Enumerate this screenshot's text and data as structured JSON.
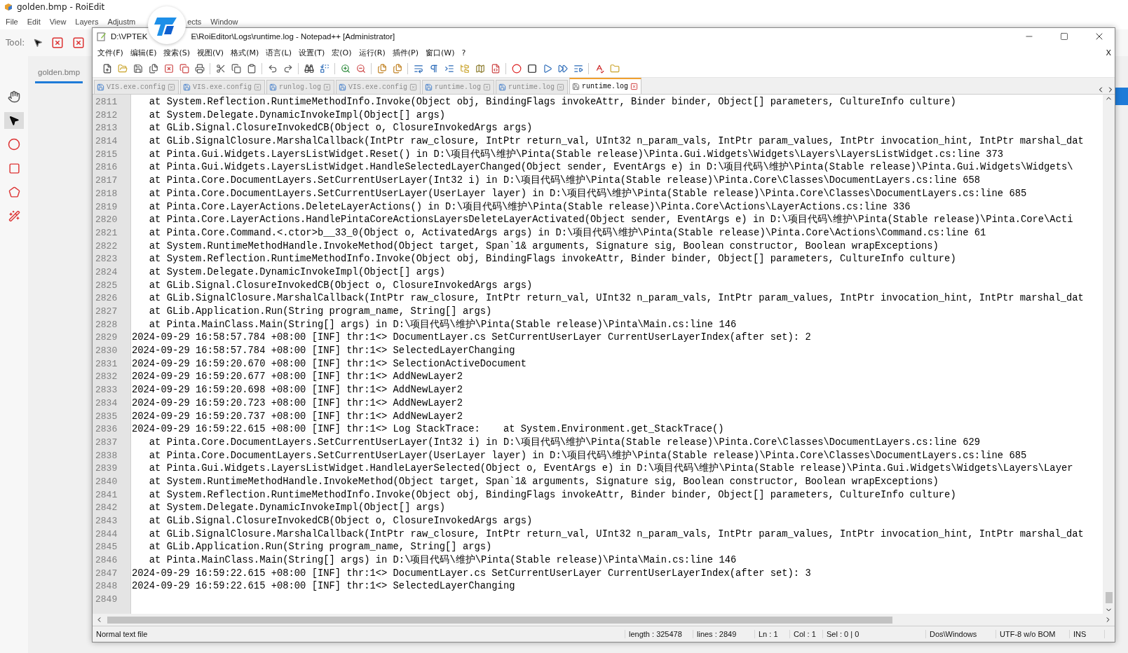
{
  "background_app": {
    "title": "golden.bmp - RoiEdit",
    "menu": [
      "File",
      "Edit",
      "View",
      "Layers",
      "Adjustm",
      "ects",
      "Window"
    ],
    "tool_label": "Tool:",
    "document_tab": "golden.bmp"
  },
  "window": {
    "title_start": "D:\\VPTEK",
    "title_end": "E\\RoiEditor\\Logs\\runtime.log - Notepad++ [Administrator]"
  },
  "menu": [
    "文件(F)",
    "编辑(E)",
    "搜索(S)",
    "视图(V)",
    "格式(M)",
    "语言(L)",
    "设置(T)",
    "宏(O)",
    "运行(R)",
    "插件(P)",
    "窗口(W)",
    "?"
  ],
  "menu_close": "X",
  "tabs": [
    {
      "label": "VIS.exe.config",
      "selected": false
    },
    {
      "label": "VIS.exe.config",
      "selected": false
    },
    {
      "label": "runlog.log",
      "selected": false
    },
    {
      "label": "VIS.exe.config",
      "selected": false
    },
    {
      "label": "runtime.log",
      "selected": false
    },
    {
      "label": "runtime.log",
      "selected": false
    },
    {
      "label": "runtime.log",
      "selected": true
    }
  ],
  "lines": [
    {
      "number": "2811",
      "kind": "trace",
      "text": "at System.Reflection.RuntimeMethodInfo.Invoke(Object obj, BindingFlags invokeAttr, Binder binder, Object[] parameters, CultureInfo culture)"
    },
    {
      "number": "2812",
      "kind": "trace",
      "text": "at System.Delegate.DynamicInvokeImpl(Object[] args)"
    },
    {
      "number": "2813",
      "kind": "trace",
      "text": "at GLib.Signal.ClosureInvokedCB(Object o, ClosureInvokedArgs args)"
    },
    {
      "number": "2814",
      "kind": "trace",
      "text": "at GLib.SignalClosure.MarshalCallback(IntPtr raw_closure, IntPtr return_val, UInt32 n_param_vals, IntPtr param_values, IntPtr invocation_hint, IntPtr marshal_dat"
    },
    {
      "number": "2815",
      "kind": "trace",
      "text": "at Pinta.Gui.Widgets.LayersListWidget.Reset() in D:\\项目代码\\维护\\Pinta(Stable release)\\Pinta.Gui.Widgets\\Widgets\\Layers\\LayersListWidget.cs:line 373"
    },
    {
      "number": "2816",
      "kind": "trace",
      "text": "at Pinta.Gui.Widgets.LayersListWidget.HandleSelectedLayerChanged(Object sender, EventArgs e) in D:\\项目代码\\维护\\Pinta(Stable release)\\Pinta.Gui.Widgets\\Widgets\\"
    },
    {
      "number": "2817",
      "kind": "trace",
      "text": "at Pinta.Core.DocumentLayers.SetCurrentUserLayer(Int32 i) in D:\\项目代码\\维护\\Pinta(Stable release)\\Pinta.Core\\Classes\\DocumentLayers.cs:line 658"
    },
    {
      "number": "2818",
      "kind": "trace",
      "text": "at Pinta.Core.DocumentLayers.SetCurrentUserLayer(UserLayer layer) in D:\\项目代码\\维护\\Pinta(Stable release)\\Pinta.Core\\Classes\\DocumentLayers.cs:line 685"
    },
    {
      "number": "2819",
      "kind": "trace",
      "text": "at Pinta.Core.LayerActions.DeleteLayerActions() in D:\\项目代码\\维护\\Pinta(Stable release)\\Pinta.Core\\Actions\\LayerActions.cs:line 336"
    },
    {
      "number": "2820",
      "kind": "trace",
      "text": "at Pinta.Core.LayerActions.HandlePintaCoreActionsLayersDeleteLayerActivated(Object sender, EventArgs e) in D:\\项目代码\\维护\\Pinta(Stable release)\\Pinta.Core\\Acti"
    },
    {
      "number": "2821",
      "kind": "trace",
      "text": "at Pinta.Core.Command.<.ctor>b__33_0(Object o, ActivatedArgs args) in D:\\项目代码\\维护\\Pinta(Stable release)\\Pinta.Core\\Actions\\Command.cs:line 61"
    },
    {
      "number": "2822",
      "kind": "trace",
      "text": "at System.RuntimeMethodHandle.InvokeMethod(Object target, Span`1& arguments, Signature sig, Boolean constructor, Boolean wrapExceptions)"
    },
    {
      "number": "2823",
      "kind": "trace",
      "text": "at System.Reflection.RuntimeMethodInfo.Invoke(Object obj, BindingFlags invokeAttr, Binder binder, Object[] parameters, CultureInfo culture)"
    },
    {
      "number": "2824",
      "kind": "trace",
      "text": "at System.Delegate.DynamicInvokeImpl(Object[] args)"
    },
    {
      "number": "2825",
      "kind": "trace",
      "text": "at GLib.Signal.ClosureInvokedCB(Object o, ClosureInvokedArgs args)"
    },
    {
      "number": "2826",
      "kind": "trace",
      "text": "at GLib.SignalClosure.MarshalCallback(IntPtr raw_closure, IntPtr return_val, UInt32 n_param_vals, IntPtr param_values, IntPtr invocation_hint, IntPtr marshal_dat"
    },
    {
      "number": "2827",
      "kind": "trace",
      "text": "at GLib.Application.Run(String program_name, String[] args)"
    },
    {
      "number": "2828",
      "kind": "trace",
      "text": "at Pinta.MainClass.Main(String[] args) in D:\\项目代码\\维护\\Pinta(Stable release)\\Pinta\\Main.cs:line 146"
    },
    {
      "number": "2829",
      "kind": "log",
      "text": "2024-09-29 16:58:57.784 +08:00 [INF] thr:1<> DocumentLayer.cs SetCurrentUserLayer CurrentUserLayerIndex(after set): 2"
    },
    {
      "number": "2830",
      "kind": "log",
      "text": "2024-09-29 16:58:57.784 +08:00 [INF] thr:1<> SelectedLayerChanging"
    },
    {
      "number": "2831",
      "kind": "log",
      "text": "2024-09-29 16:59:20.670 +08:00 [INF] thr:1<> SelectionActiveDocument"
    },
    {
      "number": "2832",
      "kind": "log",
      "text": "2024-09-29 16:59:20.677 +08:00 [INF] thr:1<> AddNewLayer2"
    },
    {
      "number": "2833",
      "kind": "log",
      "text": "2024-09-29 16:59:20.698 +08:00 [INF] thr:1<> AddNewLayer2"
    },
    {
      "number": "2834",
      "kind": "log",
      "text": "2024-09-29 16:59:20.723 +08:00 [INF] thr:1<> AddNewLayer2"
    },
    {
      "number": "2835",
      "kind": "log",
      "text": "2024-09-29 16:59:20.737 +08:00 [INF] thr:1<> AddNewLayer2"
    },
    {
      "number": "2836",
      "kind": "log",
      "text": "2024-09-29 16:59:22.615 +08:00 [INF] thr:1<> Log StackTrace:    at System.Environment.get_StackTrace()"
    },
    {
      "number": "2837",
      "kind": "trace",
      "text": "at Pinta.Core.DocumentLayers.SetCurrentUserLayer(Int32 i) in D:\\项目代码\\维护\\Pinta(Stable release)\\Pinta.Core\\Classes\\DocumentLayers.cs:line 629"
    },
    {
      "number": "2838",
      "kind": "trace",
      "text": "at Pinta.Core.DocumentLayers.SetCurrentUserLayer(UserLayer layer) in D:\\项目代码\\维护\\Pinta(Stable release)\\Pinta.Core\\Classes\\DocumentLayers.cs:line 685"
    },
    {
      "number": "2839",
      "kind": "trace",
      "text": "at Pinta.Gui.Widgets.LayersListWidget.HandleLayerSelected(Object o, EventArgs e) in D:\\项目代码\\维护\\Pinta(Stable release)\\Pinta.Gui.Widgets\\Widgets\\Layers\\Layer"
    },
    {
      "number": "2840",
      "kind": "trace",
      "text": "at System.RuntimeMethodHandle.InvokeMethod(Object target, Span`1& arguments, Signature sig, Boolean constructor, Boolean wrapExceptions)"
    },
    {
      "number": "2841",
      "kind": "trace",
      "text": "at System.Reflection.RuntimeMethodInfo.Invoke(Object obj, BindingFlags invokeAttr, Binder binder, Object[] parameters, CultureInfo culture)"
    },
    {
      "number": "2842",
      "kind": "trace",
      "text": "at System.Delegate.DynamicInvokeImpl(Object[] args)"
    },
    {
      "number": "2843",
      "kind": "trace",
      "text": "at GLib.Signal.ClosureInvokedCB(Object o, ClosureInvokedArgs args)"
    },
    {
      "number": "2844",
      "kind": "trace",
      "text": "at GLib.SignalClosure.MarshalCallback(IntPtr raw_closure, IntPtr return_val, UInt32 n_param_vals, IntPtr param_values, IntPtr invocation_hint, IntPtr marshal_dat"
    },
    {
      "number": "2845",
      "kind": "trace",
      "text": "at GLib.Application.Run(String program_name, String[] args)"
    },
    {
      "number": "2846",
      "kind": "trace",
      "text": "at Pinta.MainClass.Main(String[] args) in D:\\项目代码\\维护\\Pinta(Stable release)\\Pinta\\Main.cs:line 146"
    },
    {
      "number": "2847",
      "kind": "log",
      "text": "2024-09-29 16:59:22.615 +08:00 [INF] thr:1<> DocumentLayer.cs SetCurrentUserLayer CurrentUserLayerIndex(after set): 3"
    },
    {
      "number": "2848",
      "kind": "log",
      "text": "2024-09-29 16:59:22.615 +08:00 [INF] thr:1<> SelectedLayerChanging"
    },
    {
      "number": "2849",
      "kind": "empty"
    }
  ],
  "status_bar": {
    "file_type": "Normal text file",
    "length": "length : 325478",
    "lines": "lines : 2849",
    "ln": "Ln : 1",
    "col": "Col : 1",
    "sel": "Sel : 0 | 0",
    "eol": "Dos\\Windows",
    "encoding": "UTF-8 w/o BOM",
    "mode": "INS"
  }
}
